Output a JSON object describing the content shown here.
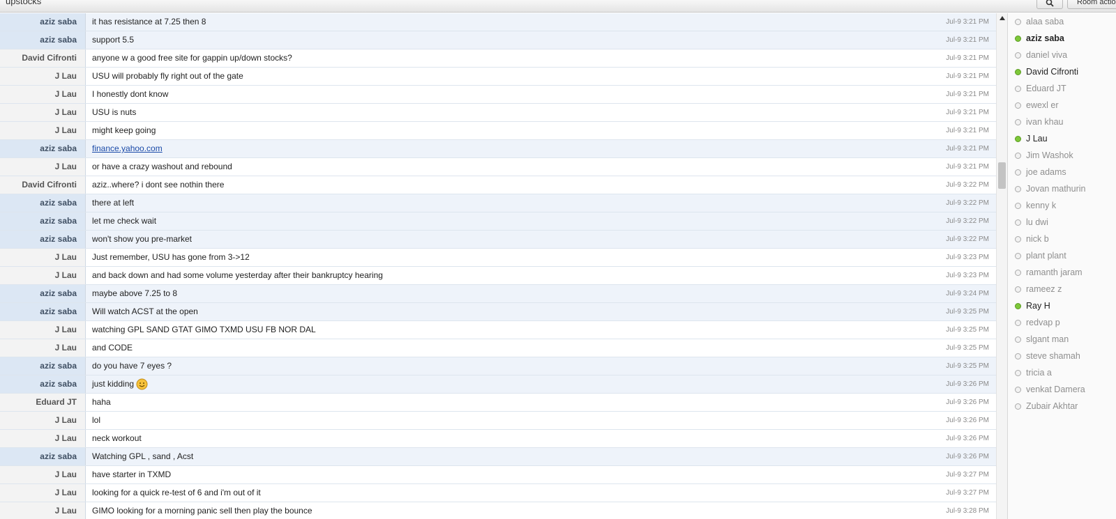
{
  "room": {
    "title": "upstocks",
    "room_actions_label": "Room actions"
  },
  "messages": [
    {
      "user": "aziz saba",
      "text": "it has resistance at 7.25 then 8",
      "time": "Jul-9 3:21 PM",
      "self": true
    },
    {
      "user": "aziz saba",
      "text": "support 5.5",
      "time": "Jul-9 3:21 PM",
      "self": true
    },
    {
      "user": "David Cifronti",
      "text": "anyone w a good free site for gappin up/down stocks?",
      "time": "Jul-9 3:21 PM",
      "self": false
    },
    {
      "user": "J Lau",
      "text": "USU will probably fly right out of the gate",
      "time": "Jul-9 3:21 PM",
      "self": false
    },
    {
      "user": "J Lau",
      "text": "I honestly dont know",
      "time": "Jul-9 3:21 PM",
      "self": false
    },
    {
      "user": "J Lau",
      "text": "USU is nuts",
      "time": "Jul-9 3:21 PM",
      "self": false
    },
    {
      "user": "J Lau",
      "text": "might keep going",
      "time": "Jul-9 3:21 PM",
      "self": false
    },
    {
      "user": "aziz saba",
      "text": "finance.yahoo.com",
      "time": "Jul-9 3:21 PM",
      "self": true,
      "link": true
    },
    {
      "user": "J Lau",
      "text": "or have a crazy washout and rebound",
      "time": "Jul-9 3:21 PM",
      "self": false
    },
    {
      "user": "David Cifronti",
      "text": "aziz..where? i dont see nothin there",
      "time": "Jul-9 3:22 PM",
      "self": false
    },
    {
      "user": "aziz saba",
      "text": "there at left",
      "time": "Jul-9 3:22 PM",
      "self": true
    },
    {
      "user": "aziz saba",
      "text": "let me check wait",
      "time": "Jul-9 3:22 PM",
      "self": true
    },
    {
      "user": "aziz saba",
      "text": "won't show you pre-market",
      "time": "Jul-9 3:22 PM",
      "self": true
    },
    {
      "user": "J Lau",
      "text": "Just remember, USU has gone from 3->12",
      "time": "Jul-9 3:23 PM",
      "self": false
    },
    {
      "user": "J Lau",
      "text": "and back down and had some volume yesterday after their bankruptcy hearing",
      "time": "Jul-9 3:23 PM",
      "self": false
    },
    {
      "user": "aziz saba",
      "text": "maybe above 7.25 to 8",
      "time": "Jul-9 3:24 PM",
      "self": true
    },
    {
      "user": "aziz saba",
      "text": "Will watch ACST at the open",
      "time": "Jul-9 3:25 PM",
      "self": true
    },
    {
      "user": "J Lau",
      "text": "watching GPL SAND GTAT GIMO TXMD USU FB NOR DAL",
      "time": "Jul-9 3:25 PM",
      "self": false
    },
    {
      "user": "J Lau",
      "text": "and CODE",
      "time": "Jul-9 3:25 PM",
      "self": false
    },
    {
      "user": "aziz saba",
      "text": "do you have 7 eyes ?",
      "time": "Jul-9 3:25 PM",
      "self": true
    },
    {
      "user": "aziz saba",
      "text": "just kidding",
      "time": "Jul-9 3:26 PM",
      "self": true,
      "emoji": "smiley-icon"
    },
    {
      "user": "Eduard JT",
      "text": "haha",
      "time": "Jul-9 3:26 PM",
      "self": false
    },
    {
      "user": "J Lau",
      "text": "lol",
      "time": "Jul-9 3:26 PM",
      "self": false
    },
    {
      "user": "J Lau",
      "text": "neck workout",
      "time": "Jul-9 3:26 PM",
      "self": false
    },
    {
      "user": "aziz saba",
      "text": "Watching GPL , sand , Acst",
      "time": "Jul-9 3:26 PM",
      "self": true
    },
    {
      "user": "J Lau",
      "text": "have starter in TXMD",
      "time": "Jul-9 3:27 PM",
      "self": false
    },
    {
      "user": "J Lau",
      "text": "looking for a quick re-test of 6 and i'm out of it",
      "time": "Jul-9 3:27 PM",
      "self": false
    },
    {
      "user": "J Lau",
      "text": "GIMO looking for a morning panic sell then play the bounce",
      "time": "Jul-9 3:28 PM",
      "self": false
    }
  ],
  "users": [
    {
      "name": "alaa saba",
      "online": false
    },
    {
      "name": "aziz saba",
      "online": true,
      "current": true
    },
    {
      "name": "daniel viva",
      "online": false
    },
    {
      "name": "David Cifronti",
      "online": true
    },
    {
      "name": "Eduard JT",
      "online": false
    },
    {
      "name": "ewexl er",
      "online": false
    },
    {
      "name": "ivan khau",
      "online": false
    },
    {
      "name": "J Lau",
      "online": true
    },
    {
      "name": "Jim Washok",
      "online": false
    },
    {
      "name": "joe adams",
      "online": false
    },
    {
      "name": "Jovan mathurin",
      "online": false
    },
    {
      "name": "kenny k",
      "online": false
    },
    {
      "name": "lu dwi",
      "online": false
    },
    {
      "name": "nick b",
      "online": false
    },
    {
      "name": "plant plant",
      "online": false
    },
    {
      "name": "ramanth jaram",
      "online": false
    },
    {
      "name": "rameez z",
      "online": false
    },
    {
      "name": "Ray H",
      "online": true
    },
    {
      "name": "redvap p",
      "online": false
    },
    {
      "name": "slgant man",
      "online": false
    },
    {
      "name": "steve shamah",
      "online": false
    },
    {
      "name": "tricia a",
      "online": false
    },
    {
      "name": "venkat Damera",
      "online": false
    },
    {
      "name": "Zubair Akhtar",
      "online": false
    }
  ],
  "colors": {
    "online_dot": "#7ec83a",
    "self_row": "#eef3fa",
    "link": "#1a4aa8"
  }
}
